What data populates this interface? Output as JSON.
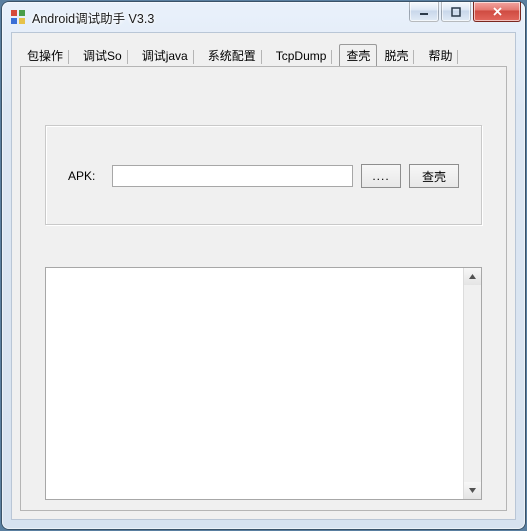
{
  "window": {
    "title": "Android调试助手 V3.3"
  },
  "tabs": [
    {
      "label": "包操作"
    },
    {
      "label": "调试So"
    },
    {
      "label": "调试java"
    },
    {
      "label": "系统配置"
    },
    {
      "label": "TcpDump"
    },
    {
      "label": "查壳"
    },
    {
      "label": "脱壳"
    },
    {
      "label": "帮助"
    }
  ],
  "active_tab_index": 5,
  "apk_group": {
    "label": "APK:",
    "path_value": "",
    "browse_label": "....",
    "check_label": "查壳"
  },
  "output_text": ""
}
